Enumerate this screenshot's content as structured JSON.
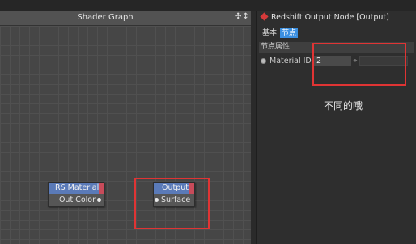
{
  "shader_graph": {
    "title": "Shader Graph",
    "tools_label": "✣↕"
  },
  "nodes": {
    "rs_material": {
      "title": "RS Material",
      "port": "Out Color"
    },
    "output": {
      "title": "Output",
      "port": "Surface"
    }
  },
  "attributes": {
    "title": "Redshift Output Node [Output]",
    "tabs": [
      "基本",
      "节点"
    ],
    "active_tab": "节点",
    "section": "节点属性",
    "field_label": "Material ID",
    "field_value": "2",
    "spinner": "÷"
  },
  "note": "不同的哦",
  "colors": {
    "node_header": "#5a7ab8",
    "node_tab": "#c84b5a",
    "highlight": "#e03434",
    "active_tab": "#3b8fe0"
  }
}
